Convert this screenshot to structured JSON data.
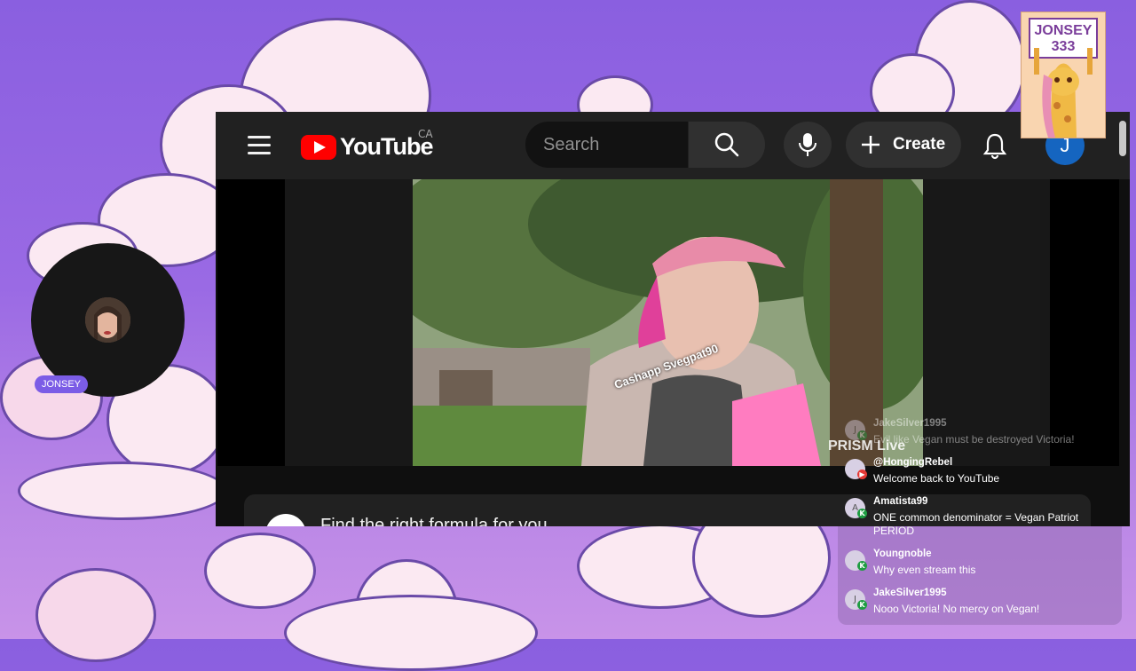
{
  "youtube": {
    "logo_text": "YouTube",
    "region": "CA",
    "search_placeholder": "Search",
    "create_label": "Create",
    "avatar_letter": "J",
    "promo_text": "Find the right formula for you"
  },
  "video": {
    "overlay_text": "Cashapp Svegpat90",
    "watermark": "PRISM Live"
  },
  "webcam": {
    "name": "JONSEY"
  },
  "badge": {
    "line1": "JONSEY",
    "line2": "333"
  },
  "chat": {
    "messages": [
      {
        "user": "JakeSilver1995",
        "text": "Evil like Vegan must be destroyed Victoria!",
        "avatar": "J",
        "badge": "green"
      },
      {
        "user": "@HongingRebel",
        "text": "Welcome back to YouTube",
        "avatar": "",
        "badge": "red"
      },
      {
        "user": "Amatista99",
        "text": "ONE common denominator = Vegan Patriot PERIOD",
        "avatar": "A",
        "badge": "green"
      },
      {
        "user": "Youngnoble",
        "text": "Why even stream this",
        "avatar": "",
        "badge": "green"
      },
      {
        "user": "JakeSilver1995",
        "text": "Nooo Victoria! No mercy on Vegan!",
        "avatar": "J",
        "badge": "green"
      }
    ]
  },
  "colors": {
    "youtube_red": "#ff0000",
    "background_purple": "#8a5fe0",
    "name_tag": "#7b5ce6"
  }
}
